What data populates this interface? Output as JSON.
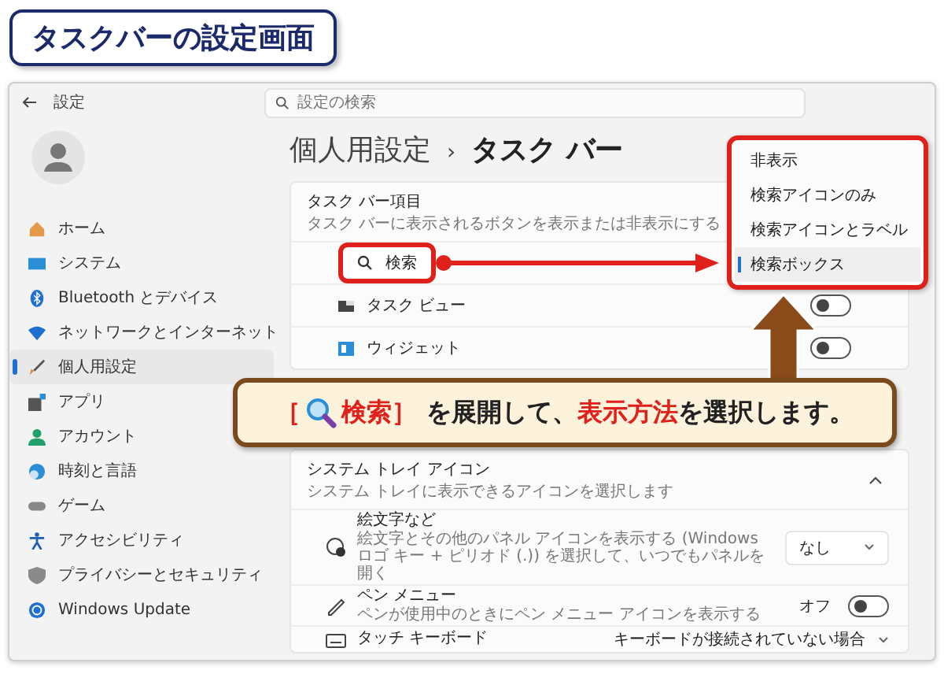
{
  "title_badge": "タスクバーの設定画面",
  "window": {
    "app_title": "設定",
    "search": {
      "placeholder": "設定の検索"
    }
  },
  "sidebar": {
    "items": [
      {
        "label": "ホーム",
        "selected": false
      },
      {
        "label": "システム",
        "selected": false
      },
      {
        "label": "Bluetooth とデバイス",
        "selected": false
      },
      {
        "label": "ネットワークとインターネット",
        "selected": false
      },
      {
        "label": "個人用設定",
        "selected": true
      },
      {
        "label": "アプリ",
        "selected": false
      },
      {
        "label": "アカウント",
        "selected": false
      },
      {
        "label": "時刻と言語",
        "selected": false
      },
      {
        "label": "ゲーム",
        "selected": false
      },
      {
        "label": "アクセシビリティ",
        "selected": false
      },
      {
        "label": "プライバシーとセキュリティ",
        "selected": false
      },
      {
        "label": "Windows Update",
        "selected": false
      }
    ]
  },
  "breadcrumb": {
    "parent": "個人用設定",
    "separator": "›",
    "current": "タスク バー"
  },
  "taskbar_items": {
    "title": "タスク バー項目",
    "subtitle": "タスク バーに表示されるボタンを表示または非表示にする",
    "items": [
      {
        "kind": "dropdown",
        "label": "検索"
      },
      {
        "kind": "toggle",
        "label": "タスク ビュー",
        "on": false
      },
      {
        "kind": "toggle",
        "label": "ウィジェット",
        "on": false
      }
    ]
  },
  "search_menu": {
    "options": [
      {
        "label": "非表示",
        "selected": false
      },
      {
        "label": "検索アイコンのみ",
        "selected": false
      },
      {
        "label": "検索アイコンとラベル",
        "selected": false
      },
      {
        "label": "検索ボックス",
        "selected": true
      }
    ]
  },
  "callout": {
    "open_bracket": "［",
    "parts": [
      {
        "text": "検索］",
        "highlight": true
      },
      {
        "text": " を展開して、",
        "highlight": false
      },
      {
        "text": "表示方法",
        "highlight": true
      },
      {
        "text": "を選択します。",
        "highlight": false
      }
    ]
  },
  "tray_section": {
    "title": "システム トレイ アイコン",
    "subtitle": "システム トレイに表示できるアイコンを選択します",
    "expanded": true,
    "items": [
      {
        "kind": "dropdown",
        "title": "絵文字など",
        "description": "絵文字とその他のパネル アイコンを表示する (Windows ロゴ キー + ピリオド (.)) を選択して、いつでもパネルを開く",
        "value": "なし"
      },
      {
        "kind": "toggle",
        "title": "ペン メニュー",
        "description": "ペンが使用中のときにペン メニュー アイコンを表示する",
        "state_label": "オフ",
        "on": false
      },
      {
        "kind": "dropdown",
        "title": "タッチ キーボード",
        "value": "キーボードが接続されていない場合"
      }
    ]
  }
}
